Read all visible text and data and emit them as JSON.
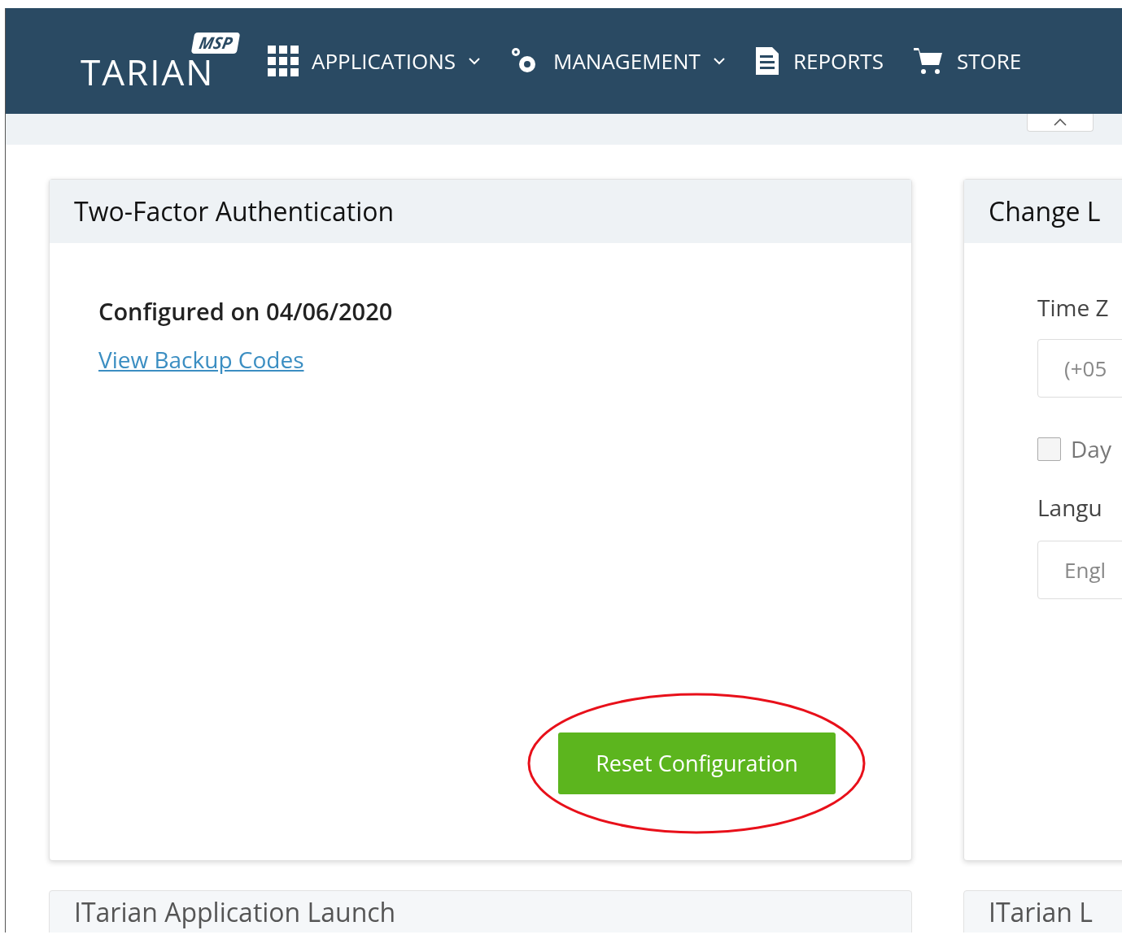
{
  "logo": {
    "badge": "MSP",
    "wordmark": "TARIAN"
  },
  "nav": [
    {
      "kind": "grid",
      "label": "APPLICATIONS",
      "dropdown": true
    },
    {
      "kind": "gears",
      "label": "MANAGEMENT",
      "dropdown": true
    },
    {
      "kind": "document",
      "label": "REPORTS",
      "dropdown": false
    },
    {
      "kind": "cart",
      "label": "STORE",
      "dropdown": false
    }
  ],
  "two_factor": {
    "title": "Two-Factor Authentication",
    "configured": "Configured on 04/06/2020",
    "link": "View Backup Codes",
    "button": "Reset Configuration"
  },
  "locale": {
    "title": "Change L",
    "timezone_label": "Time Z",
    "timezone_value": "(+05",
    "daylight": {
      "label": "Day",
      "checked": false
    },
    "language_label": "Langu",
    "language_value": "Engl"
  },
  "bottom_cards": [
    "ITarian Application Launch",
    "ITarian L"
  ]
}
